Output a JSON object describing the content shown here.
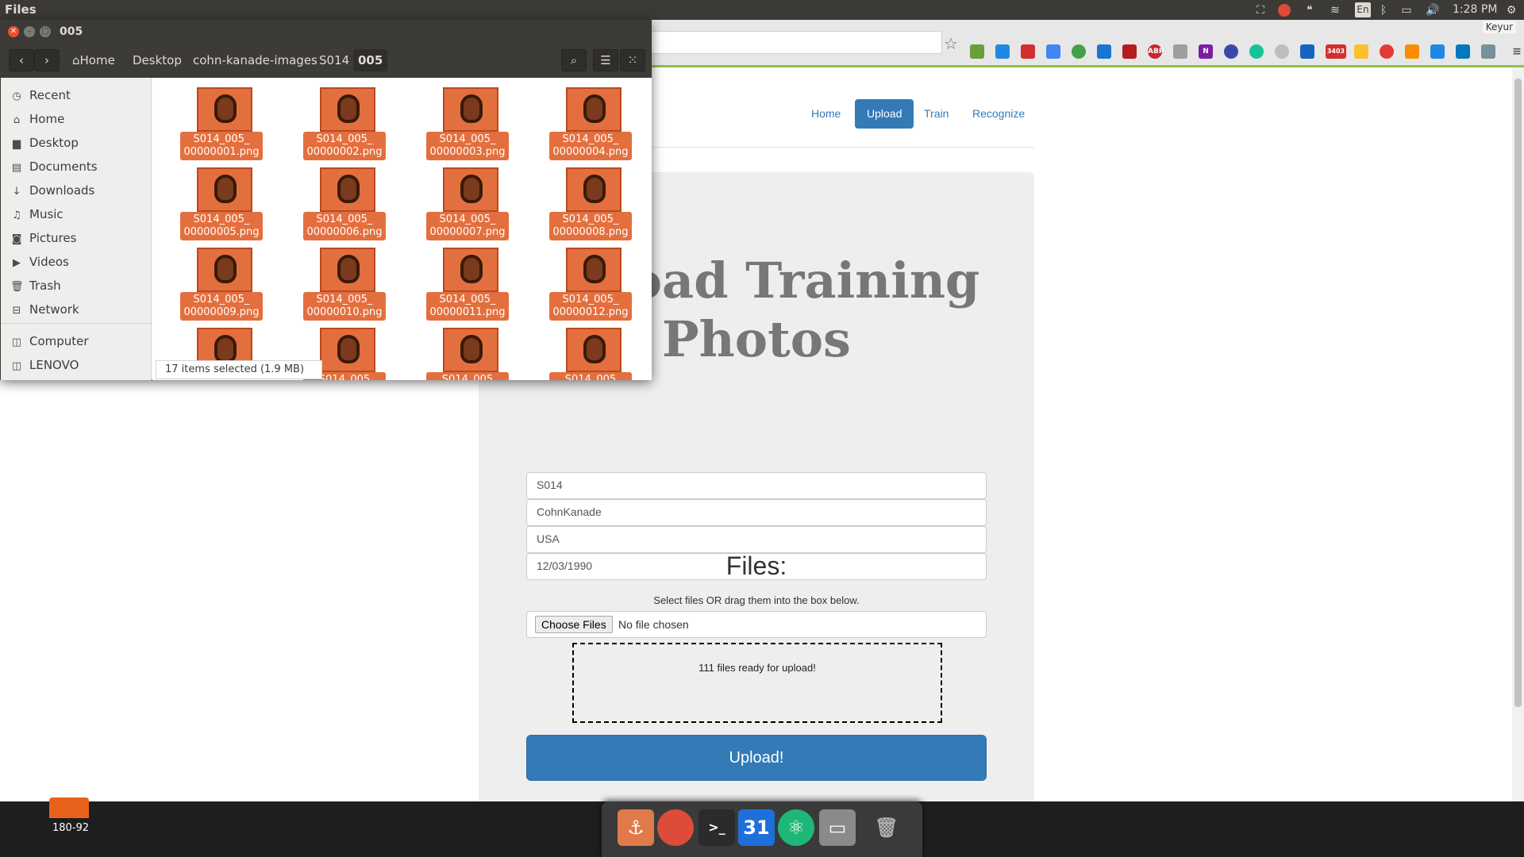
{
  "topbar": {
    "app_name": "Files",
    "language": "En",
    "time": "1:28 PM"
  },
  "browser": {
    "profile": "Keyur",
    "ext_badges": {
      "gmail": "3403",
      "abp": "ABP",
      "onenote": "N"
    }
  },
  "site": {
    "nav": {
      "home": "Home",
      "upload": "Upload",
      "train": "Train",
      "recognize": "Recognize"
    },
    "title_line1": "Upload Training",
    "title_line2": "Photos",
    "form": {
      "subject": "S014",
      "dataset": "CohnKanade",
      "country": "USA",
      "date": "12/03/1990"
    },
    "files_heading": "Files:",
    "files_hint": "Select files OR drag them into the box below.",
    "choose_files": "Choose Files",
    "no_file": "No file chosen",
    "drop_status": "111 files ready for upload!",
    "upload_button": "Upload!"
  },
  "file_manager": {
    "window_title": "005",
    "breadcrumbs": [
      "Home",
      "Desktop",
      "cohn-kanade-images",
      "S014",
      "005"
    ],
    "sidebar": [
      "Recent",
      "Home",
      "Desktop",
      "Documents",
      "Downloads",
      "Music",
      "Pictures",
      "Videos",
      "Trash",
      "Network"
    ],
    "devices": [
      "Computer",
      "LENOVO"
    ],
    "files": [
      {
        "l1": "S014_005_",
        "l2": "00000001.png"
      },
      {
        "l1": "S014_005_",
        "l2": "00000002.png"
      },
      {
        "l1": "S014_005_",
        "l2": "00000003.png"
      },
      {
        "l1": "S014_005_",
        "l2": "00000004.png"
      },
      {
        "l1": "S014_005_",
        "l2": "00000005.png"
      },
      {
        "l1": "S014_005_",
        "l2": "00000006.png"
      },
      {
        "l1": "S014_005_",
        "l2": "00000007.png"
      },
      {
        "l1": "S014_005_",
        "l2": "00000008.png"
      },
      {
        "l1": "S014_005_",
        "l2": "00000009.png"
      },
      {
        "l1": "S014_005_",
        "l2": "00000010.png"
      },
      {
        "l1": "S014_005_",
        "l2": "00000011.png"
      },
      {
        "l1": "S014_005_",
        "l2": "00000012.png"
      },
      {
        "l1": "",
        "l2": ""
      },
      {
        "l1": "S014_005",
        "l2": ""
      },
      {
        "l1": "S014_005",
        "l2": ""
      },
      {
        "l1": "S014_005",
        "l2": ""
      }
    ],
    "status": "17 items selected  (1.9 MB)"
  },
  "desktop": {
    "folder_label": "180-92"
  },
  "dock": {
    "calendar_day": "31"
  }
}
